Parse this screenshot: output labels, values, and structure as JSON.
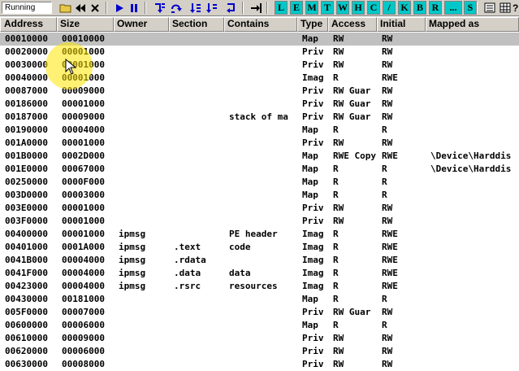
{
  "toolbar": {
    "status": "Running",
    "letters": [
      "L",
      "E",
      "M",
      "T",
      "W",
      "H",
      "C",
      "/",
      "K",
      "B",
      "R",
      "...",
      "S"
    ],
    "active_letters": [
      "L",
      "E",
      "M",
      "T",
      "W",
      "H",
      "C",
      "/",
      "K",
      "B",
      "R",
      "...",
      "S"
    ]
  },
  "columns": [
    "Address",
    "Size",
    "Owner",
    "Section",
    "Contains",
    "Type",
    "Access",
    "Initial",
    "Mapped as"
  ],
  "rows": [
    {
      "address": "00010000",
      "size": "00010000",
      "owner": "",
      "section": "",
      "contains": "",
      "type": "Map",
      "access": "RW",
      "initial": "RW",
      "mapped": ""
    },
    {
      "address": "00020000",
      "size": "00001000",
      "owner": "",
      "section": "",
      "contains": "",
      "type": "Priv",
      "access": "RW",
      "initial": "RW",
      "mapped": ""
    },
    {
      "address": "00030000",
      "size": "00001000",
      "owner": "",
      "section": "",
      "contains": "",
      "type": "Priv",
      "access": "RW",
      "initial": "RW",
      "mapped": ""
    },
    {
      "address": "00040000",
      "size": "00001000",
      "owner": "",
      "section": "",
      "contains": "",
      "type": "Imag",
      "access": "R",
      "initial": "RWE",
      "mapped": ""
    },
    {
      "address": "00087000",
      "size": "00009000",
      "owner": "",
      "section": "",
      "contains": "",
      "type": "Priv",
      "access": "RW  Guar",
      "initial": "RW",
      "mapped": ""
    },
    {
      "address": "00186000",
      "size": "00001000",
      "owner": "",
      "section": "",
      "contains": "",
      "type": "Priv",
      "access": "RW  Guar",
      "initial": "RW",
      "mapped": ""
    },
    {
      "address": "00187000",
      "size": "00009000",
      "owner": "",
      "section": "",
      "contains": "stack of ma",
      "type": "Priv",
      "access": "RW  Guar",
      "initial": "RW",
      "mapped": ""
    },
    {
      "address": "00190000",
      "size": "00004000",
      "owner": "",
      "section": "",
      "contains": "",
      "type": "Map",
      "access": "R",
      "initial": "R",
      "mapped": ""
    },
    {
      "address": "001A0000",
      "size": "00001000",
      "owner": "",
      "section": "",
      "contains": "",
      "type": "Priv",
      "access": "RW",
      "initial": "RW",
      "mapped": ""
    },
    {
      "address": "001B0000",
      "size": "0002D000",
      "owner": "",
      "section": "",
      "contains": "",
      "type": "Map",
      "access": "RWE Copy",
      "initial": "RWE",
      "mapped": "\\Device\\Harddis"
    },
    {
      "address": "001E0000",
      "size": "00067000",
      "owner": "",
      "section": "",
      "contains": "",
      "type": "Map",
      "access": "R",
      "initial": "R",
      "mapped": "\\Device\\Harddis"
    },
    {
      "address": "00250000",
      "size": "0000F000",
      "owner": "",
      "section": "",
      "contains": "",
      "type": "Map",
      "access": "R",
      "initial": "R",
      "mapped": ""
    },
    {
      "address": "003D0000",
      "size": "00003000",
      "owner": "",
      "section": "",
      "contains": "",
      "type": "Map",
      "access": "R",
      "initial": "R",
      "mapped": ""
    },
    {
      "address": "003E0000",
      "size": "00001000",
      "owner": "",
      "section": "",
      "contains": "",
      "type": "Priv",
      "access": "RW",
      "initial": "RW",
      "mapped": ""
    },
    {
      "address": "003F0000",
      "size": "00001000",
      "owner": "",
      "section": "",
      "contains": "",
      "type": "Priv",
      "access": "RW",
      "initial": "RW",
      "mapped": ""
    },
    {
      "address": "00400000",
      "size": "00001000",
      "owner": "ipmsg",
      "section": "",
      "contains": "PE header",
      "type": "Imag",
      "access": "R",
      "initial": "RWE",
      "mapped": ""
    },
    {
      "address": "00401000",
      "size": "0001A000",
      "owner": "ipmsg",
      "section": ".text",
      "contains": "code",
      "type": "Imag",
      "access": "R",
      "initial": "RWE",
      "mapped": ""
    },
    {
      "address": "0041B000",
      "size": "00004000",
      "owner": "ipmsg",
      "section": ".rdata",
      "contains": "",
      "type": "Imag",
      "access": "R",
      "initial": "RWE",
      "mapped": ""
    },
    {
      "address": "0041F000",
      "size": "00004000",
      "owner": "ipmsg",
      "section": ".data",
      "contains": "data",
      "type": "Imag",
      "access": "R",
      "initial": "RWE",
      "mapped": ""
    },
    {
      "address": "00423000",
      "size": "00004000",
      "owner": "ipmsg",
      "section": ".rsrc",
      "contains": "resources",
      "type": "Imag",
      "access": "R",
      "initial": "RWE",
      "mapped": ""
    },
    {
      "address": "00430000",
      "size": "00181000",
      "owner": "",
      "section": "",
      "contains": "",
      "type": "Map",
      "access": "R",
      "initial": "R",
      "mapped": ""
    },
    {
      "address": "005F0000",
      "size": "00007000",
      "owner": "",
      "section": "",
      "contains": "",
      "type": "Priv",
      "access": "RW  Guar",
      "initial": "RW",
      "mapped": ""
    },
    {
      "address": "00600000",
      "size": "00006000",
      "owner": "",
      "section": "",
      "contains": "",
      "type": "Map",
      "access": "R",
      "initial": "R",
      "mapped": ""
    },
    {
      "address": "00610000",
      "size": "00009000",
      "owner": "",
      "section": "",
      "contains": "",
      "type": "Priv",
      "access": "RW",
      "initial": "RW",
      "mapped": ""
    },
    {
      "address": "00620000",
      "size": "00006000",
      "owner": "",
      "section": "",
      "contains": "",
      "type": "Priv",
      "access": "RW",
      "initial": "RW",
      "mapped": ""
    },
    {
      "address": "00630000",
      "size": "00008000",
      "owner": "",
      "section": "",
      "contains": "",
      "type": "Priv",
      "access": "RW",
      "initial": "RW",
      "mapped": ""
    }
  ],
  "selected_row": 0
}
